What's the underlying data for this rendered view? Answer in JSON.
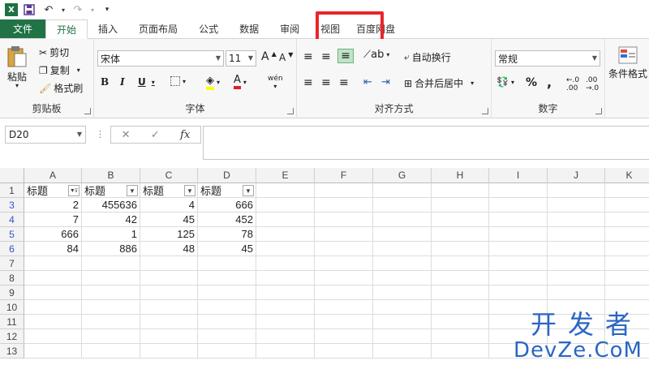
{
  "qat": {
    "app_icon": "X",
    "save_icon": "save-icon",
    "undo_icon": "undo-icon",
    "redo_icon": "redo-icon"
  },
  "tabs": [
    "文件",
    "开始",
    "插入",
    "页面布局",
    "公式",
    "数据",
    "审阅",
    "视图",
    "百度网盘"
  ],
  "ribbon": {
    "clipboard": {
      "paste": "粘贴",
      "cut": "剪切",
      "copy": "复制",
      "painter": "格式刷",
      "label": "剪贴板"
    },
    "font": {
      "name": "宋体",
      "size": "11",
      "bold": "B",
      "italic": "I",
      "underline": "U",
      "wen": "wén",
      "label": "字体",
      "grow": "A",
      "shrink": "A"
    },
    "align": {
      "wrap": "自动换行",
      "merge": "合并后居中",
      "label": "对齐方式"
    },
    "number": {
      "format": "常规",
      "label": "数字"
    },
    "styles": {
      "cond": "条件格式"
    }
  },
  "formula_bar": {
    "name_box": "D20",
    "cancel": "✕",
    "enter": "✓",
    "fx": "fx"
  },
  "columns": [
    "A",
    "B",
    "C",
    "D",
    "E",
    "F",
    "G",
    "H",
    "I",
    "J",
    "K"
  ],
  "rows": [
    {
      "num": "1",
      "blue": false,
      "cells": [
        "标题",
        "标题",
        "标题",
        "标题"
      ],
      "header": true
    },
    {
      "num": "3",
      "blue": true,
      "cells": [
        "2",
        "455636",
        "4",
        "666"
      ]
    },
    {
      "num": "4",
      "blue": true,
      "cells": [
        "7",
        "42",
        "45",
        "452"
      ]
    },
    {
      "num": "5",
      "blue": true,
      "cells": [
        "666",
        "1",
        "125",
        "78"
      ]
    },
    {
      "num": "6",
      "blue": true,
      "cells": [
        "84",
        "886",
        "48",
        "45"
      ]
    },
    {
      "num": "7",
      "blue": false,
      "cells": []
    },
    {
      "num": "8",
      "blue": false,
      "cells": []
    },
    {
      "num": "9",
      "blue": false,
      "cells": []
    },
    {
      "num": "10",
      "blue": false,
      "cells": []
    },
    {
      "num": "11",
      "blue": false,
      "cells": []
    },
    {
      "num": "12",
      "blue": false,
      "cells": []
    },
    {
      "num": "13",
      "blue": false,
      "cells": []
    }
  ],
  "watermark": {
    "line1": "开发者",
    "line2": "DevZe.CoM"
  }
}
